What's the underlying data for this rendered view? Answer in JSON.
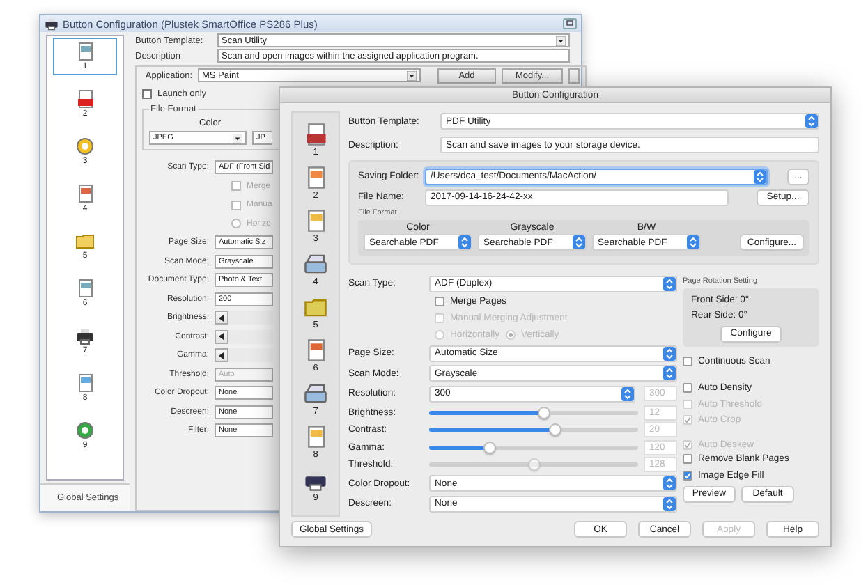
{
  "back_window": {
    "title": "Button Configuration (Plustek SmartOffice PS286 Plus)",
    "sidebar": {
      "items": [
        {
          "label": "1",
          "selected": true
        },
        {
          "label": "2",
          "selected": false
        },
        {
          "label": "3",
          "selected": false
        },
        {
          "label": "4",
          "selected": false
        },
        {
          "label": "5",
          "selected": false
        },
        {
          "label": "6",
          "selected": false
        },
        {
          "label": "7",
          "selected": false
        },
        {
          "label": "8",
          "selected": false
        },
        {
          "label": "9",
          "selected": false
        }
      ]
    },
    "tab": "Global Settings",
    "header_rows": [
      {
        "kind": "select",
        "label": "Button Template:",
        "value": "Scan Utility"
      },
      {
        "kind": "text",
        "label": "Description",
        "value": "Scan and open images within the assigned application program."
      }
    ],
    "application": {
      "label": "Application:",
      "value": "MS Paint",
      "buttons": [
        "Add",
        "Modify..."
      ]
    },
    "launch_only": {
      "label": "Launch only",
      "checked": false
    },
    "file_format": {
      "title": "File Format",
      "header": "Color",
      "values": [
        "JPEG",
        "JP"
      ]
    },
    "rows": [
      {
        "kind": "select",
        "label": "Scan Type:",
        "value": "ADF (Front Sid"
      },
      {
        "kind": "checkbox",
        "label": "Merge",
        "checked": false,
        "disabled": true
      },
      {
        "kind": "checkbox",
        "label": "Manua",
        "checked": false,
        "disabled": true
      },
      {
        "kind": "radio",
        "label": "Horizo",
        "selected": false,
        "disabled": true
      },
      {
        "kind": "select",
        "label": "Page Size:",
        "value": "Automatic Siz"
      },
      {
        "kind": "select",
        "label": "Scan Mode:",
        "value": "Grayscale"
      },
      {
        "kind": "select",
        "label": "Document Type:",
        "value": "Photo & Text"
      },
      {
        "kind": "select",
        "label": "Resolution:",
        "value": "200"
      },
      {
        "kind": "slider",
        "label": "Brightness:"
      },
      {
        "kind": "slider",
        "label": "Contrast:"
      },
      {
        "kind": "slider",
        "label": "Gamma:"
      },
      {
        "kind": "disabled",
        "label": "Threshold:",
        "value": "Auto"
      },
      {
        "kind": "select",
        "label": "Color Dropout:",
        "value": "None"
      },
      {
        "kind": "select",
        "label": "Descreen:",
        "value": "None"
      },
      {
        "kind": "select",
        "label": "Filter:",
        "value": "None"
      }
    ]
  },
  "front_window": {
    "title": "Button Configuration",
    "sidebar": {
      "items": [
        {
          "label": "1",
          "selected": false
        },
        {
          "label": "2",
          "selected": false
        },
        {
          "label": "3",
          "selected": false
        },
        {
          "label": "4",
          "selected": false
        },
        {
          "label": "5",
          "selected": false
        },
        {
          "label": "6",
          "selected": false
        },
        {
          "label": "7",
          "selected": false
        },
        {
          "label": "8",
          "selected": false
        },
        {
          "label": "9",
          "selected": false
        }
      ]
    },
    "header_rows": [
      {
        "kind": "select",
        "label": "Button Template:",
        "value": "PDF Utility"
      },
      {
        "kind": "text",
        "label": "Description:",
        "value": "Scan and save images to your storage device."
      }
    ],
    "saving_folder": {
      "label": "Saving Folder:",
      "value": "/Users/dca_test/Documents/MacAction/",
      "button": "..."
    },
    "file_name": {
      "label": "File Name:",
      "value": "2017-09-14-16-24-42-xx",
      "button": "Setup..."
    },
    "file_format": {
      "title": "File Format",
      "columns": [
        {
          "header": "Color",
          "value": "Searchable PDF"
        },
        {
          "header": "Grayscale",
          "value": "Searchable PDF"
        },
        {
          "header": "B/W",
          "value": "Searchable PDF"
        }
      ],
      "button": "Configure..."
    },
    "rows": [
      {
        "kind": "select",
        "label": "Scan Type:",
        "value": "ADF (Duplex)"
      },
      {
        "kind": "checkbox",
        "label": "Merge Pages",
        "checked": false,
        "disabled": false
      },
      {
        "kind": "checkbox",
        "label": "Manual Merging Adjustment",
        "checked": false,
        "disabled": true
      },
      {
        "kind": "radios",
        "disabled": true,
        "options": [
          {
            "label": "Horizontally",
            "selected": false
          },
          {
            "label": "Vertically",
            "selected": true
          }
        ]
      },
      {
        "kind": "select",
        "label": "Page Size:",
        "value": "Automatic Size"
      },
      {
        "kind": "select",
        "label": "Scan Mode:",
        "value": "Grayscale"
      },
      {
        "kind": "number",
        "label": "Resolution:",
        "value": "300",
        "reading": "300"
      },
      {
        "kind": "slider",
        "label": "Brightness:",
        "level": 0.55,
        "reading": "12",
        "disabled": false
      },
      {
        "kind": "slider",
        "label": "Contrast:",
        "level": 0.6,
        "reading": "20",
        "disabled": false
      },
      {
        "kind": "slider",
        "label": "Gamma:",
        "level": 0.29,
        "reading": "120",
        "disabled": false
      },
      {
        "kind": "slider",
        "label": "Threshold:",
        "level": 0.5,
        "reading": "128",
        "disabled": true
      },
      {
        "kind": "select",
        "label": "Color Dropout:",
        "value": "None"
      },
      {
        "kind": "select",
        "label": "Descreen:",
        "value": "None"
      }
    ],
    "rotation": {
      "title": "Page Rotation Setting",
      "lines": [
        {
          "label": "Front Side:",
          "value": "0°"
        },
        {
          "label": "Rear Side:",
          "value": "0°"
        }
      ],
      "button": "Configure"
    },
    "options": [
      {
        "label": "Continuous Scan",
        "checked": false,
        "disabled": false
      },
      {
        "label": "Auto Density",
        "checked": false,
        "disabled": false
      },
      {
        "label": "Auto Threshold",
        "checked": false,
        "disabled": true
      },
      {
        "label": "Auto Crop",
        "checked": true,
        "disabled": true
      },
      {
        "label": "Auto Deskew",
        "checked": true,
        "disabled": true
      },
      {
        "label": "Remove Blank Pages",
        "checked": false,
        "disabled": false
      },
      {
        "label": "Image Edge Fill",
        "checked": true,
        "disabled": false
      }
    ],
    "option_buttons": [
      "Preview",
      "Default"
    ],
    "footer": {
      "left": "Global Settings",
      "buttons": [
        {
          "label": "OK",
          "disabled": false
        },
        {
          "label": "Cancel",
          "disabled": false
        },
        {
          "label": "Apply",
          "disabled": true
        },
        {
          "label": "Help",
          "disabled": false
        }
      ]
    }
  }
}
